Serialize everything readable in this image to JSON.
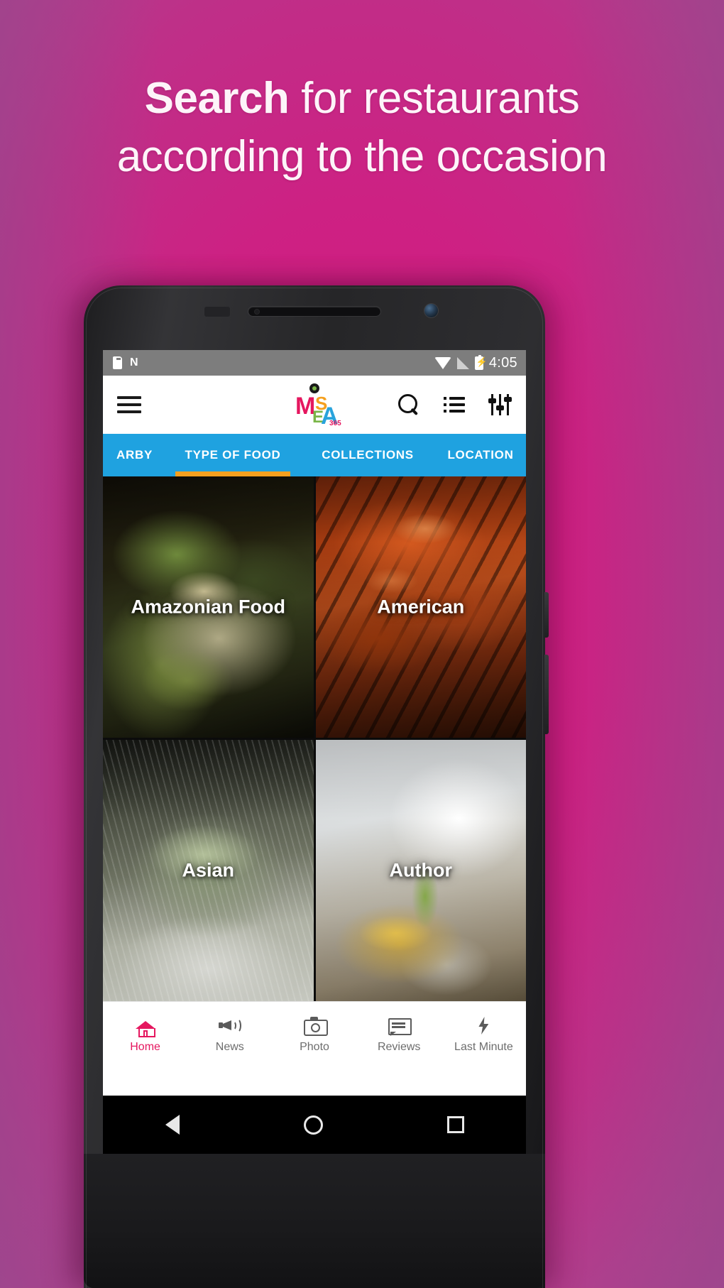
{
  "promo": {
    "line1_strong": "Search",
    "line1_rest": " for restaurants",
    "line2": "according to the occasion",
    "bg_color": "#cd2183"
  },
  "status_bar": {
    "sd_icon": "sd-card-icon",
    "nfc_icon": "N",
    "wifi_icon": "wifi-icon",
    "signal_icon": "cellular-signal-icon",
    "battery_icon": "battery-charging-icon",
    "clock": "4:05",
    "background": "#7d7d7d"
  },
  "appbar": {
    "menu_icon": "hamburger-menu-icon",
    "logo": {
      "name": "mesa-logo",
      "letters": [
        "M",
        "E",
        "S",
        "A"
      ],
      "sub": "365",
      "colors": {
        "m": "#e5175f",
        "e": "#7ab648",
        "s": "#f5a01f",
        "a": "#29a3dc",
        "dot": "#1a1a1a"
      }
    },
    "search_icon": "search-icon",
    "list_icon": "list-view-icon",
    "tune_icon": "filter-tune-icon",
    "background": "#ffffff"
  },
  "tabs": {
    "accent": "#f5a01f",
    "background": "#1fa2e0",
    "items": [
      {
        "label": "ARBY",
        "full_label": "NEARBY",
        "active": false
      },
      {
        "label": "TYPE OF FOOD",
        "active": true
      },
      {
        "label": "COLLECTIONS",
        "active": false
      },
      {
        "label": "LOCATION",
        "active": false
      }
    ]
  },
  "grid": {
    "tiles": [
      {
        "label": "Amazonian Food",
        "photo": "amazonian-food-photo"
      },
      {
        "label": "American",
        "photo": "american-bbq-ribs-photo"
      },
      {
        "label": "Asian",
        "photo": "asian-noodle-soup-photo"
      },
      {
        "label": "Author",
        "photo": "author-plated-dish-photo"
      }
    ]
  },
  "bottom_nav": {
    "active_color": "#e5175f",
    "inactive_color": "#6d6d6d",
    "items": [
      {
        "label": "Home",
        "icon": "home-icon",
        "active": true
      },
      {
        "label": "News",
        "icon": "megaphone-icon",
        "active": false
      },
      {
        "label": "Photo",
        "icon": "camera-icon",
        "active": false
      },
      {
        "label": "Reviews",
        "icon": "speech-bubble-icon",
        "active": false
      },
      {
        "label": "Last Minute",
        "icon": "lightning-bolt-icon",
        "active": false
      }
    ]
  },
  "android_nav": {
    "back_icon": "back-triangle-icon",
    "home_icon": "home-circle-icon",
    "recents_icon": "recents-square-icon"
  }
}
